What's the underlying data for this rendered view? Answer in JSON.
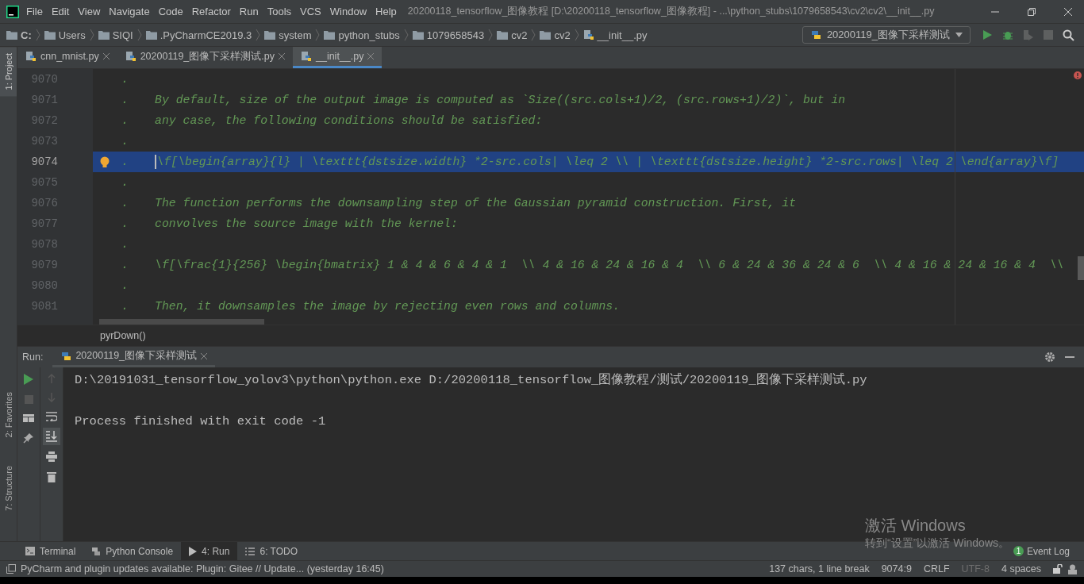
{
  "window": {
    "title": "20200118_tensorflow_图像教程 [D:\\20200118_tensorflow_图像教程] - ...\\python_stubs\\1079658543\\cv2\\cv2\\__init__.py"
  },
  "menu": [
    "File",
    "Edit",
    "View",
    "Navigate",
    "Code",
    "Refactor",
    "Run",
    "Tools",
    "VCS",
    "Window",
    "Help"
  ],
  "breadcrumbs": [
    {
      "label": "C:",
      "kind": "drive"
    },
    {
      "label": "Users",
      "kind": "folder"
    },
    {
      "label": "SIQI",
      "kind": "folder"
    },
    {
      "label": ".PyCharmCE2019.3",
      "kind": "folder"
    },
    {
      "label": "system",
      "kind": "folder"
    },
    {
      "label": "python_stubs",
      "kind": "folder"
    },
    {
      "label": "1079658543",
      "kind": "folder"
    },
    {
      "label": "cv2",
      "kind": "folder"
    },
    {
      "label": "cv2",
      "kind": "folder"
    },
    {
      "label": "__init__.py",
      "kind": "file"
    }
  ],
  "run_config": {
    "label": "20200119_图像下采样测试"
  },
  "tool_stripe": [
    {
      "label": "1: Project",
      "selected": true
    },
    {
      "label": "2: Favorites",
      "selected": false
    },
    {
      "label": "7: Structure",
      "selected": false
    }
  ],
  "tabs": [
    {
      "label": "cnn_mnist.py",
      "selected": false
    },
    {
      "label": "20200119_图像下采样测试.py",
      "selected": false
    },
    {
      "label": "__init__.py",
      "selected": true
    }
  ],
  "editor": {
    "lines": [
      {
        "number": "9070",
        "dot": ".",
        "current": false
      },
      {
        "number": "9071",
        "dot": ".",
        "text": "By default, size of the output image is computed as `Size((src.cols+1)/2, (src.rows+1)/2)`, but in",
        "current": false
      },
      {
        "number": "9072",
        "dot": ".",
        "text": "any case, the following conditions should be satisfied:",
        "current": false
      },
      {
        "number": "9073",
        "dot": ".",
        "current": false
      },
      {
        "number": "9074",
        "dot": ".",
        "text": "\\f[\\begin{array}{l} | \\texttt{dstsize.width} *2-src.cols| \\leq 2 \\\\ | \\texttt{dstsize.height} *2-src.rows| \\leq 2 \\end{array}\\f]",
        "current": true
      },
      {
        "number": "9075",
        "dot": ".",
        "current": false
      },
      {
        "number": "9076",
        "dot": ".",
        "text": "The function performs the downsampling step of the Gaussian pyramid construction. First, it",
        "current": false
      },
      {
        "number": "9077",
        "dot": ".",
        "text": "convolves the source image with the kernel:",
        "current": false
      },
      {
        "number": "9078",
        "dot": ".",
        "current": false
      },
      {
        "number": "9079",
        "dot": ".",
        "text": "\\f[\\frac{1}{256} \\begin{bmatrix} 1 & 4 & 6 & 4 & 1  \\\\ 4 & 16 & 24 & 16 & 4  \\\\ 6 & 24 & 36 & 24 & 6  \\\\ 4 & 16 & 24 & 16 & 4  \\\\",
        "current": false
      },
      {
        "number": "9080",
        "dot": ".",
        "current": false
      },
      {
        "number": "9081",
        "dot": ".",
        "text": "Then, it downsamples the image by rejecting even rows and columns.",
        "current": false
      }
    ],
    "breadcrumb": "pyrDown()"
  },
  "run_panel": {
    "label": "Run:",
    "tab": "20200119_图像下采样测试",
    "output": [
      "D:\\20191031_tensorflow_yolov3\\python\\python.exe D:/20200118_tensorflow_图像教程/测试/20200119_图像下采样测试.py",
      "Process finished with exit code -1"
    ]
  },
  "bottom_tabs": [
    {
      "label": "Terminal",
      "kind": "terminal",
      "selected": false
    },
    {
      "label": "Python Console",
      "kind": "python",
      "selected": false
    },
    {
      "label": "4: Run",
      "kind": "run",
      "selected": true
    },
    {
      "label": "6: TODO",
      "kind": "todo",
      "selected": false
    }
  ],
  "event_log": {
    "label": "Event Log",
    "count": "1"
  },
  "watermark": {
    "title": "激活 Windows",
    "subtitle": "转到“设置”以激活 Windows。"
  },
  "status_bar": {
    "message": "PyCharm and plugin updates available: Plugin: Gitee // Update... (yesterday 16:45)",
    "items": [
      {
        "label": "137 chars, 1 line break",
        "disabled": false
      },
      {
        "label": "9074:9",
        "disabled": false
      },
      {
        "label": "CRLF",
        "disabled": false
      },
      {
        "label": "UTF-8",
        "disabled": true
      },
      {
        "label": "4 spaces",
        "disabled": false
      }
    ]
  }
}
